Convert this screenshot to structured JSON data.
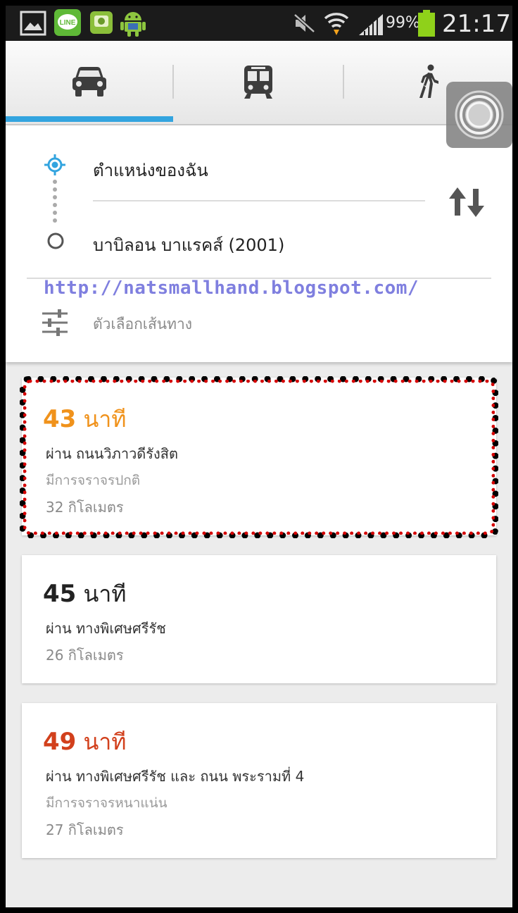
{
  "status_bar": {
    "battery_percent": "99%",
    "time": "21:17",
    "notification_icons": [
      "gallery-icon",
      "line-app-icon",
      "app-icon",
      "android-icon"
    ],
    "system_icons": [
      "silent-mode-icon",
      "wifi-icon",
      "signal-icon",
      "battery-icon"
    ],
    "line_label": "LINE"
  },
  "mode_tabs": [
    {
      "name": "car-icon",
      "active": true
    },
    {
      "name": "transit-icon",
      "active": false
    },
    {
      "name": "walk-icon",
      "active": false
    }
  ],
  "directions": {
    "origin": "ตำแหน่งของฉัน",
    "destination": "บาบิลอน บาแรคส์ (2001)",
    "route_options": "ตัวเลือกเส้นทาง"
  },
  "watermark": "http://natsmallhand.blogspot.com/",
  "routes": [
    {
      "minutes": "43",
      "unit": "นาที",
      "via": "ผ่าน ถนนวิภาวดีรังสิต",
      "traffic": "มีการจราจรปกติ",
      "distance": "32 กิโลเมตร",
      "color": "#f0921b"
    },
    {
      "minutes": "45",
      "unit": "นาที",
      "via": "ผ่าน ทางพิเศษศรีรัช",
      "traffic": "",
      "distance": "26 กิโลเมตร",
      "color": "#222222"
    },
    {
      "minutes": "49",
      "unit": "นาที",
      "via": "ผ่าน ทางพิเศษศรีรัช และ ถนน พระรามที่ 4",
      "traffic": "มีการจราจรหนาแน่น",
      "distance": "27 กิโลเมตร",
      "color": "#d2401c"
    }
  ],
  "colors": {
    "accent": "#33a4df",
    "highlight_dash": "#d40000"
  }
}
